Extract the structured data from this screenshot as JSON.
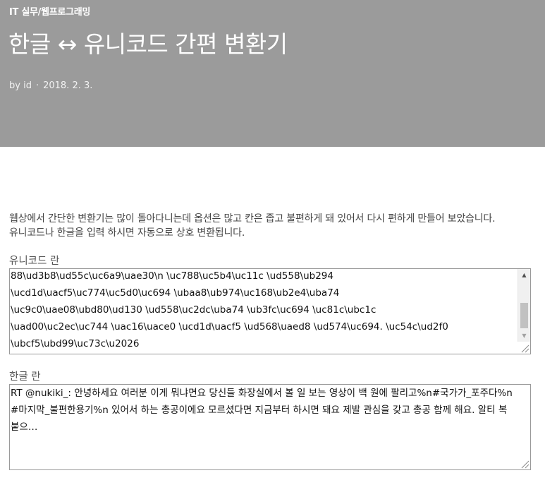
{
  "header": {
    "category": "IT 실무/웹프로그래밍",
    "title": "한글 ↔ 유니코드 간편 변환기",
    "author": "by id",
    "separator": "·",
    "date": "2018. 2. 3."
  },
  "intro": {
    "line1": "웹상에서 간단한 변환기는 많이 돌아다니는데 옵션은 많고 칸은 좁고 불편하게 돼 있어서 다시 편하게 만들어 보았습니다.",
    "line2": "유니코드나 한글을 입력 하시면 자동으로 상호 변환됩니다."
  },
  "unicode_field": {
    "label": "유니코드 란",
    "value": "88\\ud3b8\\ud55c\\uc6a9\\uae30\\n \\uc788\\uc5b4\\uc11c \\ud558\\ub294\n\\ucd1d\\uacf5\\uc774\\uc5d0\\uc694 \\ubaa8\\ub974\\uc168\\ub2e4\\uba74\n\\uc9c0\\uae08\\ubd80\\ud130 \\ud558\\uc2dc\\uba74 \\ub3fc\\uc694 \\uc81c\\ubc1c\n\\uad00\\uc2ec\\uc744 \\uac16\\uace0 \\ucd1d\\uacf5 \\ud568\\uaed8 \\ud574\\uc694. \\uc54c\\ud2f0\n\\ubcf5\\ubd99\\uc73c\\u2026"
  },
  "hangul_field": {
    "label": "한글 란",
    "value": "RT @nukiki_: 안녕하세요 여러분 이게 뭐냐면요 당신들 화장실에서 볼 일 보는 영상이 백 원에 팔리고%n#국가가_포주다%n#마지막_불편한용기%n 있어서 하는 총공이에요 모르셨다면 지금부터 하시면 돼요 제발 관심을 갖고 총공 함께 해요. 알티 복붙으…"
  },
  "icons": {
    "scroll_up": "scroll-up-arrow",
    "scroll_down": "scroll-down-arrow",
    "resize": "resize-grip"
  },
  "colors": {
    "header_bg": "#9b9b9b",
    "text": "#333333",
    "border": "#9a9a9a"
  }
}
